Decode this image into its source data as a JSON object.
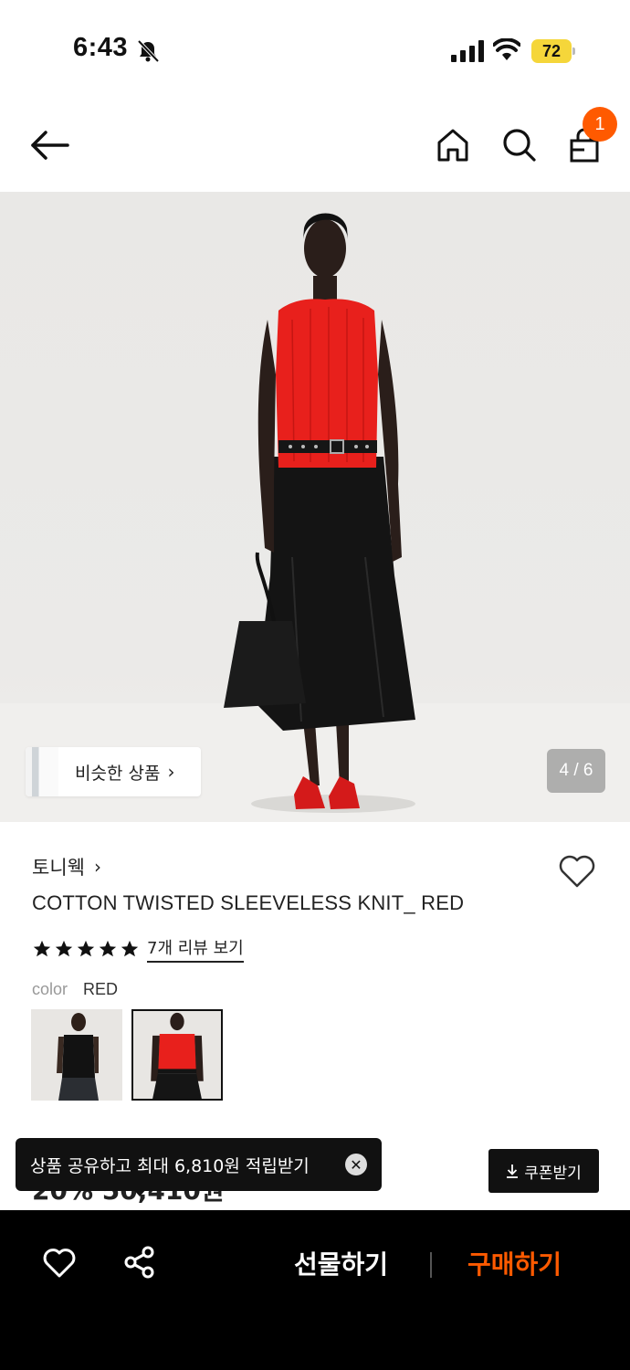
{
  "status_bar": {
    "time": "6:43",
    "battery_level": "72",
    "icons": [
      "bell-off-icon",
      "cellular-signal-icon",
      "wifi-icon",
      "battery-icon"
    ]
  },
  "nav": {
    "icons": [
      "back-arrow-icon",
      "home-icon",
      "search-icon",
      "shopping-bag-icon"
    ],
    "cart_count": "1"
  },
  "gallery": {
    "similar_products_label": "비슷한 상품",
    "pager": "4 / 6"
  },
  "product": {
    "brand": "토니웩",
    "title": "COTTON TWISTED SLEEVELESS KNIT_ RED",
    "rating_stars": 5,
    "review_link": "7개 리뷰 보기",
    "color_label": "color",
    "color_value": "RED",
    "swatches": [
      {
        "name": "BLACK",
        "selected": false
      },
      {
        "name": "RED",
        "selected": true
      }
    ]
  },
  "price": {
    "peek": "20% 50,410원"
  },
  "coupon": {
    "label": "쿠폰받기"
  },
  "toast": {
    "text": "상품 공유하고 최대 6,810원 적립받기"
  },
  "bottom_bar": {
    "gift_label": "선물하기",
    "buy_label": "구매하기"
  },
  "colors": {
    "accent": "#ff5a00",
    "battery": "#f5d63a",
    "knit_red": "#e8201c"
  }
}
